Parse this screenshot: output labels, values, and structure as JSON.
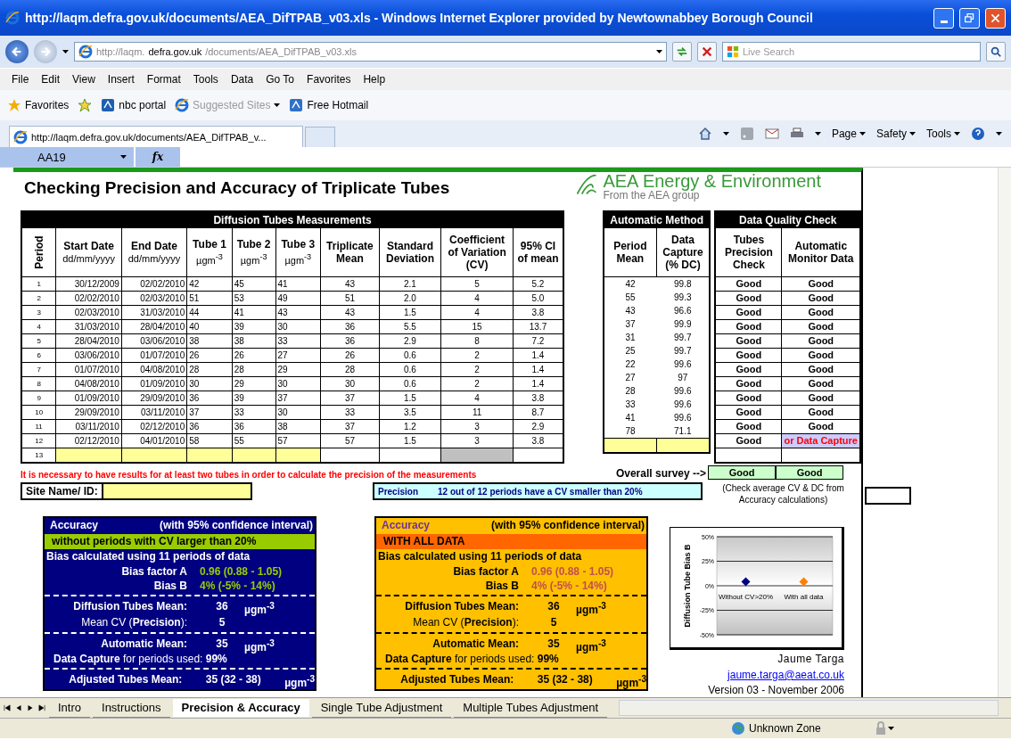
{
  "window": {
    "title": "http://laqm.defra.gov.uk/documents/AEA_DifTPAB_v03.xls - Windows Internet Explorer provided by Newtownabbey Borough Council"
  },
  "address_bar": {
    "url_parts": [
      "http://laqm.",
      "defra.gov.uk",
      "/documents/AEA_DifTPAB_v03.xls"
    ],
    "search_placeholder": "Live Search"
  },
  "menu": [
    "File",
    "Edit",
    "View",
    "Insert",
    "Format",
    "Tools",
    "Data",
    "Go To",
    "Favorites",
    "Help"
  ],
  "favorites_bar": {
    "favorites": "Favorites",
    "links": [
      {
        "label": "nbc portal",
        "disabled": false,
        "dropdown": false
      },
      {
        "label": "Suggested Sites",
        "disabled": true,
        "dropdown": true
      },
      {
        "label": "Free Hotmail",
        "disabled": false,
        "dropdown": false
      }
    ]
  },
  "browser_tab": {
    "title": "http://laqm.defra.gov.uk/documents/AEA_DifTPAB_v..."
  },
  "command_bar": [
    "Page",
    "Safety",
    "Tools"
  ],
  "formula_bar": {
    "name_box": "AA19",
    "function_label": "fx"
  },
  "sheet": {
    "title": "Checking Precision and Accuracy of Triplicate Tubes",
    "logo": {
      "name": "AEA Energy & Environment",
      "tagline": "From the AEA group"
    },
    "diffusion_table": {
      "heading": "Diffusion Tubes Measurements",
      "columns": [
        {
          "label": "Period"
        },
        {
          "label": "Start Date",
          "sub": "dd/mm/yyyy"
        },
        {
          "label": "End Date",
          "sub": "dd/mm/yyyy"
        },
        {
          "label": "Tube 1",
          "sub": "µgm$^{-3}$"
        },
        {
          "label": "Tube 2",
          "sub": "µgm$^{-3}$"
        },
        {
          "label": "Tube 3",
          "sub": "µgm$^{-3}$"
        },
        {
          "label": "Triplicate Mean"
        },
        {
          "label": "Standard Deviation"
        },
        {
          "label": "Coefficient of Variation (CV)"
        },
        {
          "label": "95% CI of mean"
        }
      ],
      "rows": [
        [
          "1",
          "30/12/2009",
          "02/02/2010",
          "42",
          "45",
          "41",
          "43",
          "2.1",
          "5",
          "5.2"
        ],
        [
          "2",
          "02/02/2010",
          "02/03/2010",
          "51",
          "53",
          "49",
          "51",
          "2.0",
          "4",
          "5.0"
        ],
        [
          "3",
          "02/03/2010",
          "31/03/2010",
          "44",
          "41",
          "43",
          "43",
          "1.5",
          "4",
          "3.8"
        ],
        [
          "4",
          "31/03/2010",
          "28/04/2010",
          "40",
          "39",
          "30",
          "36",
          "5.5",
          "15",
          "13.7"
        ],
        [
          "5",
          "28/04/2010",
          "03/06/2010",
          "38",
          "38",
          "33",
          "36",
          "2.9",
          "8",
          "7.2"
        ],
        [
          "6",
          "03/06/2010",
          "01/07/2010",
          "26",
          "26",
          "27",
          "26",
          "0.6",
          "2",
          "1.4"
        ],
        [
          "7",
          "01/07/2010",
          "04/08/2010",
          "28",
          "28",
          "29",
          "28",
          "0.6",
          "2",
          "1.4"
        ],
        [
          "8",
          "04/08/2010",
          "01/09/2010",
          "30",
          "29",
          "30",
          "30",
          "0.6",
          "2",
          "1.4"
        ],
        [
          "9",
          "01/09/2010",
          "29/09/2010",
          "36",
          "39",
          "37",
          "37",
          "1.5",
          "4",
          "3.8"
        ],
        [
          "10",
          "29/09/2010",
          "03/11/2010",
          "37",
          "33",
          "30",
          "33",
          "3.5",
          "11",
          "8.7"
        ],
        [
          "11",
          "03/11/2010",
          "02/12/2010",
          "36",
          "36",
          "38",
          "37",
          "1.2",
          "3",
          "2.9"
        ],
        [
          "12",
          "02/12/2010",
          "04/01/2010",
          "58",
          "55",
          "57",
          "57",
          "1.5",
          "3",
          "3.8"
        ]
      ],
      "blank_row": "13"
    },
    "automatic_table": {
      "heading": "Automatic Method",
      "columns": [
        "Period Mean",
        "Data Capture (% DC)"
      ],
      "rows": [
        [
          "42",
          "99.8"
        ],
        [
          "55",
          "99.3"
        ],
        [
          "43",
          "96.6"
        ],
        [
          "37",
          "99.9"
        ],
        [
          "31",
          "99.7"
        ],
        [
          "25",
          "99.7"
        ],
        [
          "22",
          "99.6"
        ],
        [
          "27",
          "97"
        ],
        [
          "28",
          "99.6"
        ],
        [
          "33",
          "99.6"
        ],
        [
          "41",
          "99.6"
        ],
        [
          "78",
          "71.1"
        ]
      ]
    },
    "quality_table": {
      "heading": "Data Quality Check",
      "columns": [
        "Tubes Precision Check",
        "Automatic Monitor Data"
      ],
      "rows": [
        {
          "precision": "Good",
          "monitor": "Good",
          "warning": false
        },
        {
          "precision": "Good",
          "monitor": "Good",
          "warning": false
        },
        {
          "precision": "Good",
          "monitor": "Good",
          "warning": false
        },
        {
          "precision": "Good",
          "monitor": "Good",
          "warning": false
        },
        {
          "precision": "Good",
          "monitor": "Good",
          "warning": false
        },
        {
          "precision": "Good",
          "monitor": "Good",
          "warning": false
        },
        {
          "precision": "Good",
          "monitor": "Good",
          "warning": false
        },
        {
          "precision": "Good",
          "monitor": "Good",
          "warning": false
        },
        {
          "precision": "Good",
          "monitor": "Good",
          "warning": false
        },
        {
          "precision": "Good",
          "monitor": "Good",
          "warning": false
        },
        {
          "precision": "Good",
          "monitor": "Good",
          "warning": false
        },
        {
          "precision": "Good",
          "monitor": "or Data Capture",
          "warning": true
        }
      ]
    },
    "warning_text": "It is necessary to have results for at least two tubes in order to calculate the precision of the measurements",
    "overall_survey": {
      "label": "Overall survey -->",
      "values": [
        "Good",
        "Good"
      ]
    },
    "site_name_label": "Site Name/ ID:",
    "precision": {
      "label": "Precision",
      "text": "12 out of 12 periods have a CV smaller than 20%"
    },
    "note": "(Check average CV & DC from Accuracy calculations)",
    "accuracy_panels": [
      {
        "kind": "filtered",
        "title": "Accuracy",
        "subtitle": "(with 95% confidence interval)",
        "band": "without periods with CV larger than 20%",
        "bias_note": "Bias calculated using 11 periods of data",
        "bias_a_label": "Bias factor A",
        "bias_a_value": "0.96 (0.88 - 1.05)",
        "bias_b_label": "Bias B",
        "bias_b_value": "4%  (-5% - 14%)",
        "tubes_mean_label": "Diffusion Tubes Mean:",
        "tubes_mean_value": "36",
        "tubes_mean_unit": "µgm$^{-3}$",
        "cv_label": "Mean CV (**Precision**):",
        "cv_value": "5",
        "auto_mean_label": "Automatic Mean:",
        "auto_mean_value": "35",
        "auto_mean_unit": "µgm$^{-3}$",
        "data_capture": "**Data Capture** for periods used: **99%**",
        "adjusted_label": "Adjusted Tubes Mean:",
        "adjusted_value": "35  (32 - 38)",
        "adjusted_unit": "µgm$^{-3}$"
      },
      {
        "kind": "all",
        "title": "Accuracy",
        "subtitle": "(with 95% confidence interval)",
        "band": "WITH ALL DATA",
        "bias_note": "Bias calculated using 11 periods of data",
        "bias_a_label": "Bias factor A",
        "bias_a_value": "0.96 (0.88 - 1.05)",
        "bias_b_label": "Bias B",
        "bias_b_value": "4%  (-5% - 14%)",
        "tubes_mean_label": "Diffusion Tubes Mean:",
        "tubes_mean_value": "36",
        "tubes_mean_unit": "µgm$^{-3}$",
        "cv_label": "Mean CV (**Precision**):",
        "cv_value": "5",
        "auto_mean_label": "Automatic Mean:",
        "auto_mean_value": "35",
        "auto_mean_unit": "µgm$^{-3}$",
        "data_capture": "**Data Capture** for periods used: **99%**",
        "adjusted_label": "Adjusted Tubes Mean:",
        "adjusted_value": "35  (32 - 38)",
        "adjusted_unit": "µgm$^{-3}$"
      }
    ],
    "chart": {
      "chart_data": {
        "type": "scatter",
        "grid": true,
        "ylabel": "Diffusion Tube Bias B",
        "categories": [
          "Without CV>20%",
          "With all data"
        ],
        "ylim": [
          -50,
          50
        ],
        "yticks": [
          {
            "value": -50,
            "label": "-50%"
          },
          {
            "value": -25,
            "label": "-25%"
          },
          {
            "value": 0,
            "label": "0%"
          },
          {
            "value": 25,
            "label": "25%"
          },
          {
            "value": 50,
            "label": "50%"
          }
        ],
        "series": [
          {
            "color": "#000080",
            "values": [
              4,
              null
            ]
          },
          {
            "color": "#ff8000",
            "values": [
              null,
              4
            ]
          }
        ]
      }
    },
    "author": "Jaume Targa",
    "email": "jaume.targa@aeat.co.uk",
    "version": "Version 03 - November 2006"
  },
  "sheet_tabs": [
    {
      "label": "Intro",
      "selected": false
    },
    {
      "label": "Instructions",
      "selected": false
    },
    {
      "label": "Precision & Accuracy",
      "selected": true
    },
    {
      "label": "Single Tube Adjustment",
      "selected": false
    },
    {
      "label": "Multiple Tubes Adjustment",
      "selected": false
    }
  ],
  "status_bar": {
    "zone": "Unknown Zone"
  }
}
